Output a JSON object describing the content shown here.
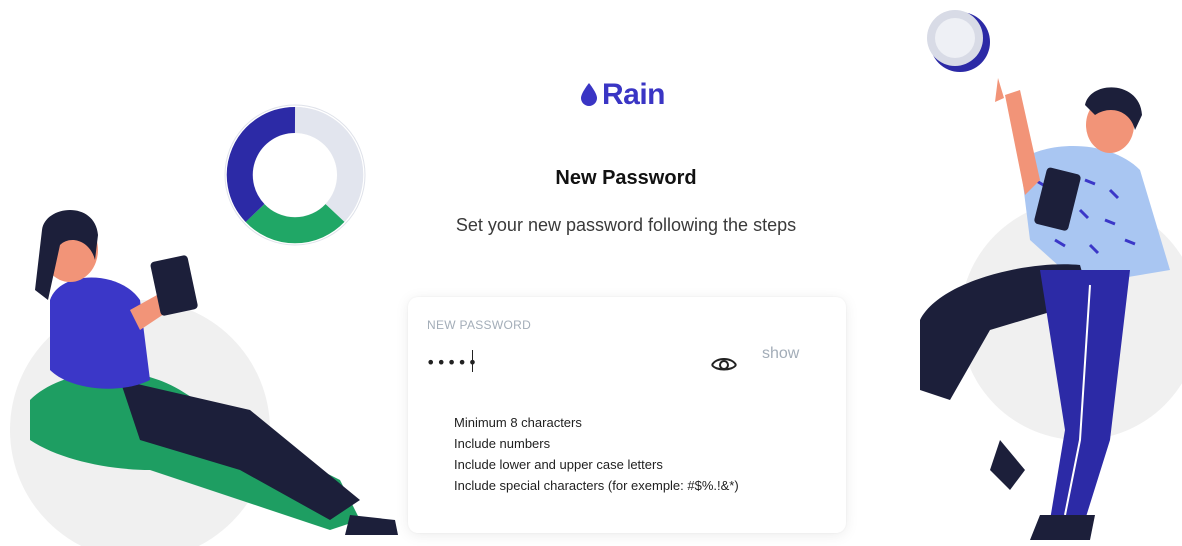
{
  "brand": {
    "name": "Rain",
    "color": "#3a35c4"
  },
  "page": {
    "title": "New Password",
    "subtitle": "Set your new password following the steps"
  },
  "form": {
    "password_label": "NEW PASSWORD",
    "password_value": "•••••",
    "show_label": "show",
    "requirements": [
      "Minimum 8 characters",
      "Include numbers",
      "Include lower and upper case letters",
      "Include special characters (for exemple: #$%.!&*)"
    ]
  },
  "icons": {
    "logo": "raindrop-icon",
    "visibility": "eye-icon"
  },
  "colors": {
    "accent_blue": "#2e2aa8",
    "accent_green": "#1fa865",
    "muted_text": "#a3adb8"
  }
}
